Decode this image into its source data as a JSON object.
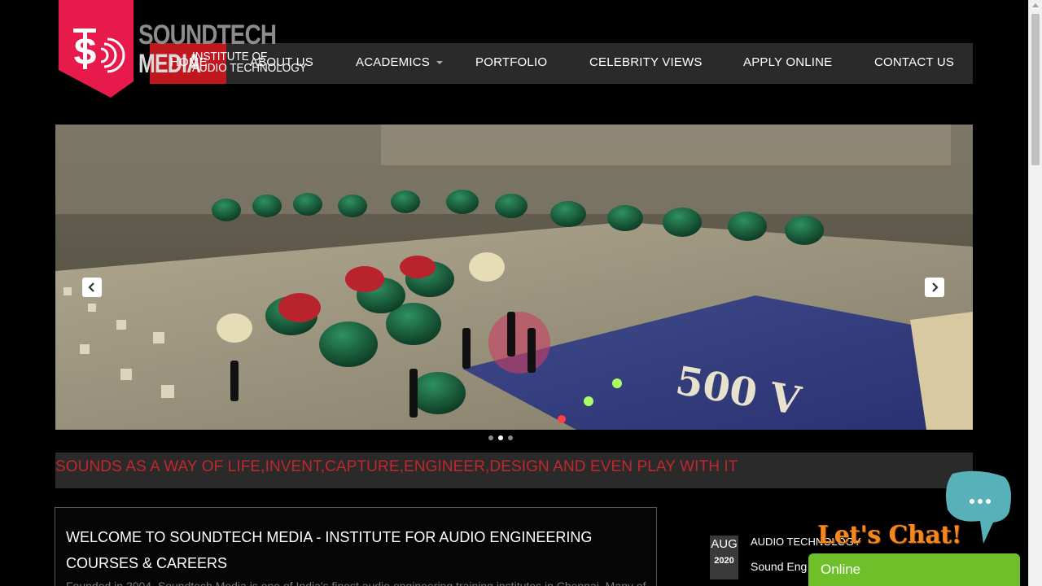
{
  "logo": {
    "line1": "SOUNDTECH",
    "line2": "MEDIA",
    "sub1": "INSTITUTE OF",
    "sub2": "AUDIO TECHNOLOGY",
    "brand_color": "#e8194b"
  },
  "nav": {
    "items": [
      {
        "label": "HOME"
      },
      {
        "label": "ABOUT US"
      },
      {
        "label": "ACADEMICS"
      },
      {
        "label": "PORTFOLIO"
      },
      {
        "label": "CELEBRITY VIEWS"
      },
      {
        "label": "APPLY ONLINE"
      },
      {
        "label": "CONTACT US"
      }
    ],
    "active_color": "#c0171f",
    "bar_color": "#2a2a2a"
  },
  "slider": {
    "slide_count": 3,
    "active_slide": 2,
    "image_text": "500 V"
  },
  "tagline": "SOUNDS AS A WAY OF LIFE,INVENT,CAPTURE,ENGINEER,DESIGN AND EVEN PLAY WITH IT",
  "welcome": {
    "title": "WELCOME TO SOUNDTECH MEDIA - INSTITUTE FOR AUDIO ENGINEERING COURSES & CAREERS",
    "body": "Founded in 2004, Soundtech Media is one of India's finest audio engineering training institutes in Chennai. Many of"
  },
  "news": {
    "month": "AUG",
    "year": "2020",
    "title": "AUDIO TECHNOLOGY",
    "subtitle": "Sound Eng"
  },
  "chat": {
    "headline": "Let's Chat!",
    "status": "Online",
    "bubble_icon": "chat-ellipsis-icon"
  }
}
